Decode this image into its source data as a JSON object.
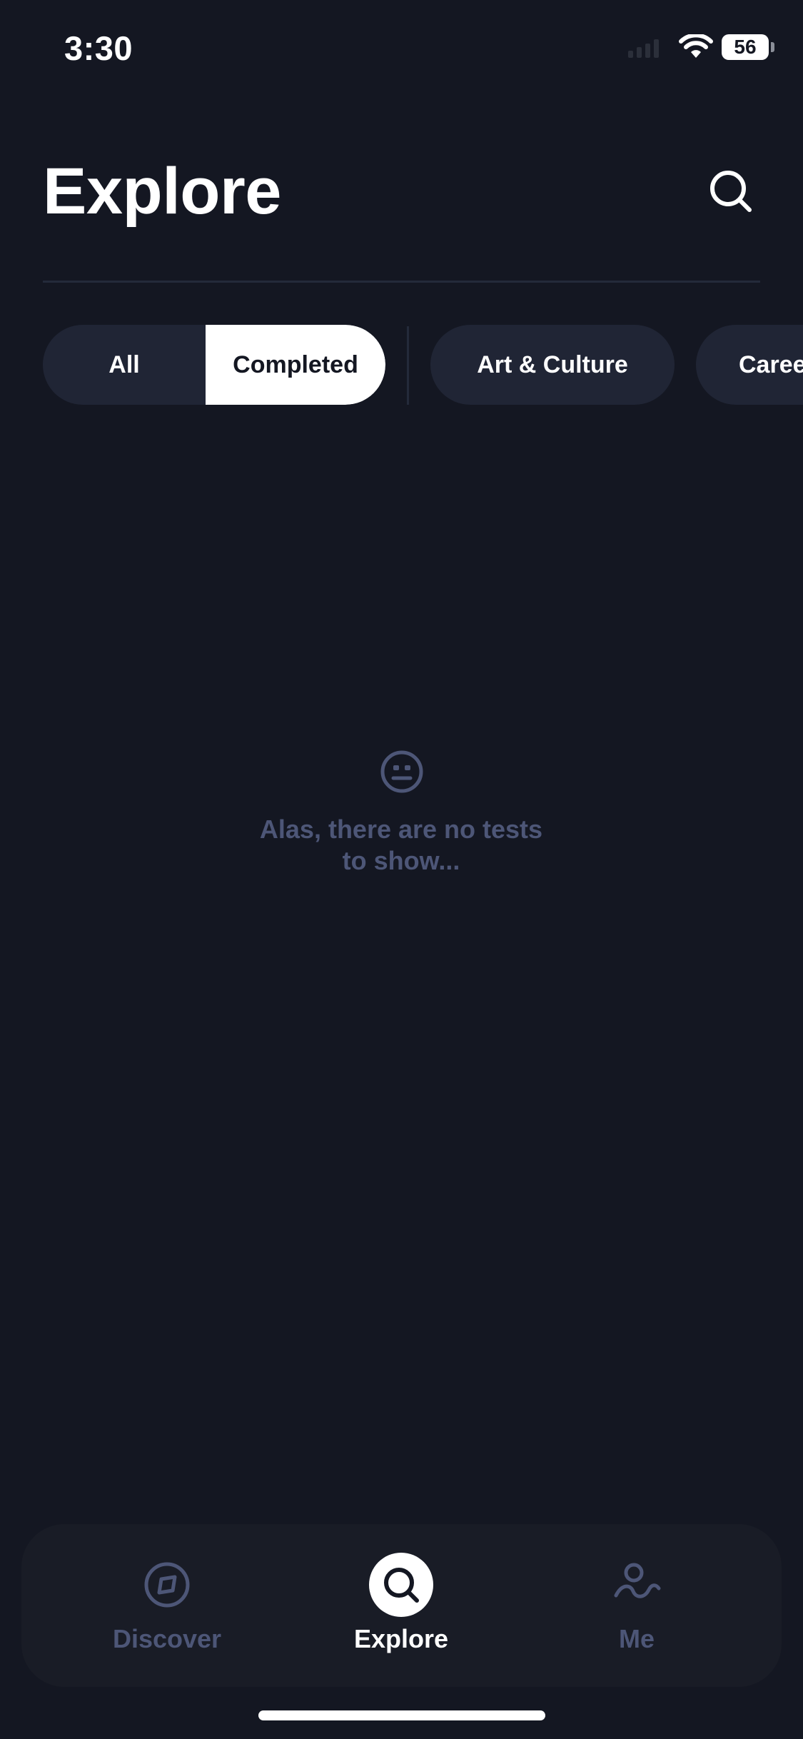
{
  "status_bar": {
    "time": "3:30",
    "battery": "56",
    "icons": [
      "signal-icon",
      "wifi-icon",
      "battery-icon"
    ]
  },
  "header": {
    "title": "Explore",
    "search_icon": "search-icon"
  },
  "filters": {
    "all_label": "All",
    "completed_label": "Completed",
    "selected": "Completed",
    "chips": [
      "Art & Culture",
      "Caree"
    ]
  },
  "empty_state": {
    "icon": "neutral-face-icon",
    "line1": "Alas, there are no tests",
    "line2": "to show..."
  },
  "tab_bar": {
    "discover_label": "Discover",
    "explore_label": "Explore",
    "me_label": "Me",
    "active": "Explore"
  },
  "colors": {
    "background": "#141722",
    "chip_bg": "#202535",
    "muted_text": "#4d5677",
    "tabbar_bg": "#191c26",
    "accent": "#ffffff"
  }
}
